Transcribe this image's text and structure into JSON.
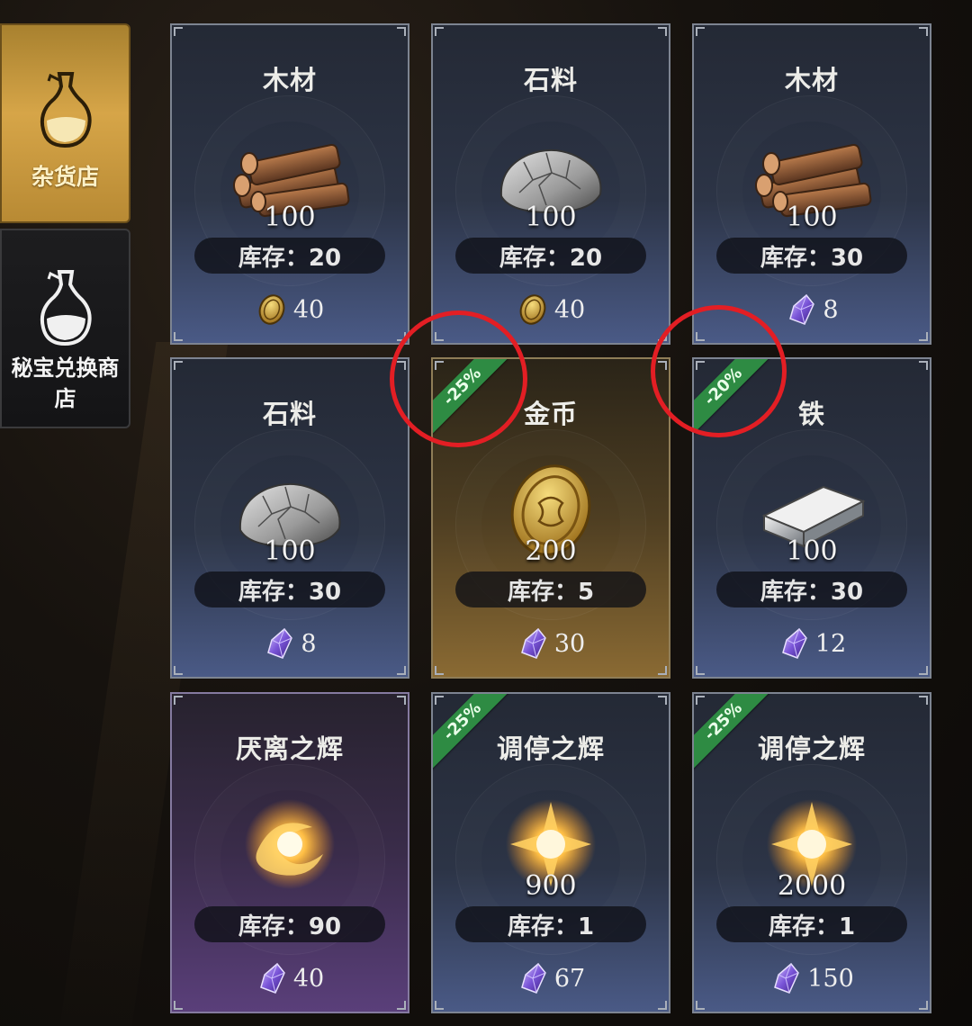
{
  "sidebar": {
    "tabs": [
      {
        "label": "杂货店",
        "icon": "flask-icon",
        "active": true
      },
      {
        "label": "秘宝兑换商店",
        "icon": "flask-icon",
        "active": false
      }
    ]
  },
  "shop": {
    "items": [
      {
        "name": "木材",
        "art": "wood-logs",
        "quantity": "100",
        "stock": "库存：20",
        "currency": "gold-coin",
        "price": "40",
        "discount": "",
        "theme": "blue"
      },
      {
        "name": "石料",
        "art": "stone",
        "quantity": "100",
        "stock": "库存：20",
        "currency": "gold-coin",
        "price": "40",
        "discount": "",
        "theme": "blue"
      },
      {
        "name": "木材",
        "art": "wood-logs",
        "quantity": "100",
        "stock": "库存：30",
        "currency": "purple-crystal",
        "price": "8",
        "discount": "",
        "theme": "blue"
      },
      {
        "name": "石料",
        "art": "stone",
        "quantity": "100",
        "stock": "库存：30",
        "currency": "purple-crystal",
        "price": "8",
        "discount": "",
        "theme": "blue"
      },
      {
        "name": "金币",
        "art": "gold-coin",
        "quantity": "200",
        "stock": "库存：5",
        "currency": "purple-crystal",
        "price": "30",
        "discount": "-25%",
        "theme": "gold"
      },
      {
        "name": "铁",
        "art": "iron-ingot",
        "quantity": "100",
        "stock": "库存：30",
        "currency": "purple-crystal",
        "price": "12",
        "discount": "-20%",
        "theme": "blue"
      },
      {
        "name": "厌离之辉",
        "art": "radiant-orb",
        "quantity": "",
        "stock": "库存：90",
        "currency": "purple-crystal",
        "price": "40",
        "discount": "",
        "theme": "purple"
      },
      {
        "name": "调停之辉",
        "art": "radiant-star",
        "quantity": "900",
        "stock": "库存：1",
        "currency": "purple-crystal",
        "price": "67",
        "discount": "-25%",
        "theme": "blue"
      },
      {
        "name": "调停之辉",
        "art": "radiant-star",
        "quantity": "2000",
        "stock": "库存：1",
        "currency": "purple-crystal",
        "price": "150",
        "discount": "-25%",
        "theme": "blue"
      }
    ]
  },
  "colors": {
    "accent_gold": "#d6a548",
    "discount_green": "#2e8b43",
    "annotation_red": "#e31e24"
  }
}
